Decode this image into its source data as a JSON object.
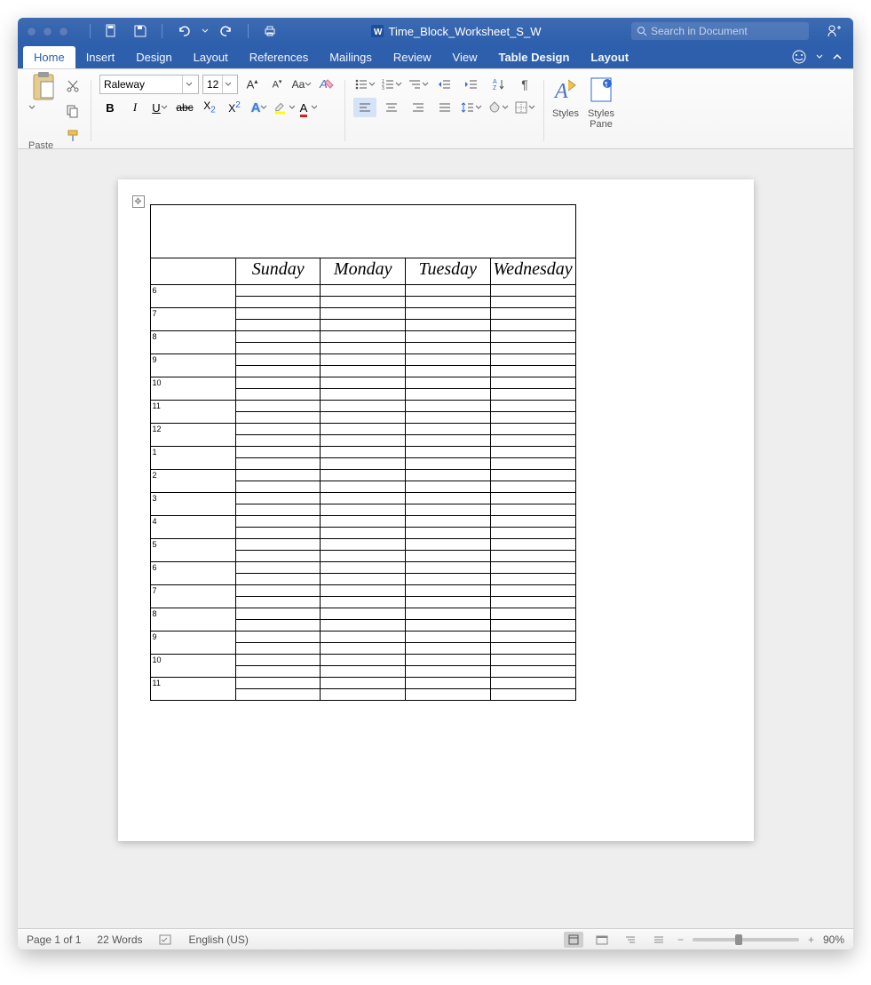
{
  "title": "Time_Block_Worksheet_S_W",
  "search_placeholder": "Search in Document",
  "tabs": [
    "Home",
    "Insert",
    "Design",
    "Layout",
    "References",
    "Mailings",
    "Review",
    "View",
    "Table Design",
    "Layout"
  ],
  "active_tab": 0,
  "ribbon": {
    "paste_label": "Paste",
    "font_name": "Raleway",
    "font_size": "12",
    "styles_label": "Styles",
    "styles_pane_label": "Styles\nPane"
  },
  "document": {
    "days": [
      "Sunday",
      "Monday",
      "Tuesday",
      "Wednesday"
    ],
    "hours": [
      "6",
      "7",
      "8",
      "9",
      "10",
      "11",
      "12",
      "1",
      "2",
      "3",
      "4",
      "5",
      "6",
      "7",
      "8",
      "9",
      "10",
      "11"
    ]
  },
  "status": {
    "page": "Page 1 of 1",
    "words": "22 Words",
    "lang": "English (US)",
    "zoom": "90%"
  }
}
